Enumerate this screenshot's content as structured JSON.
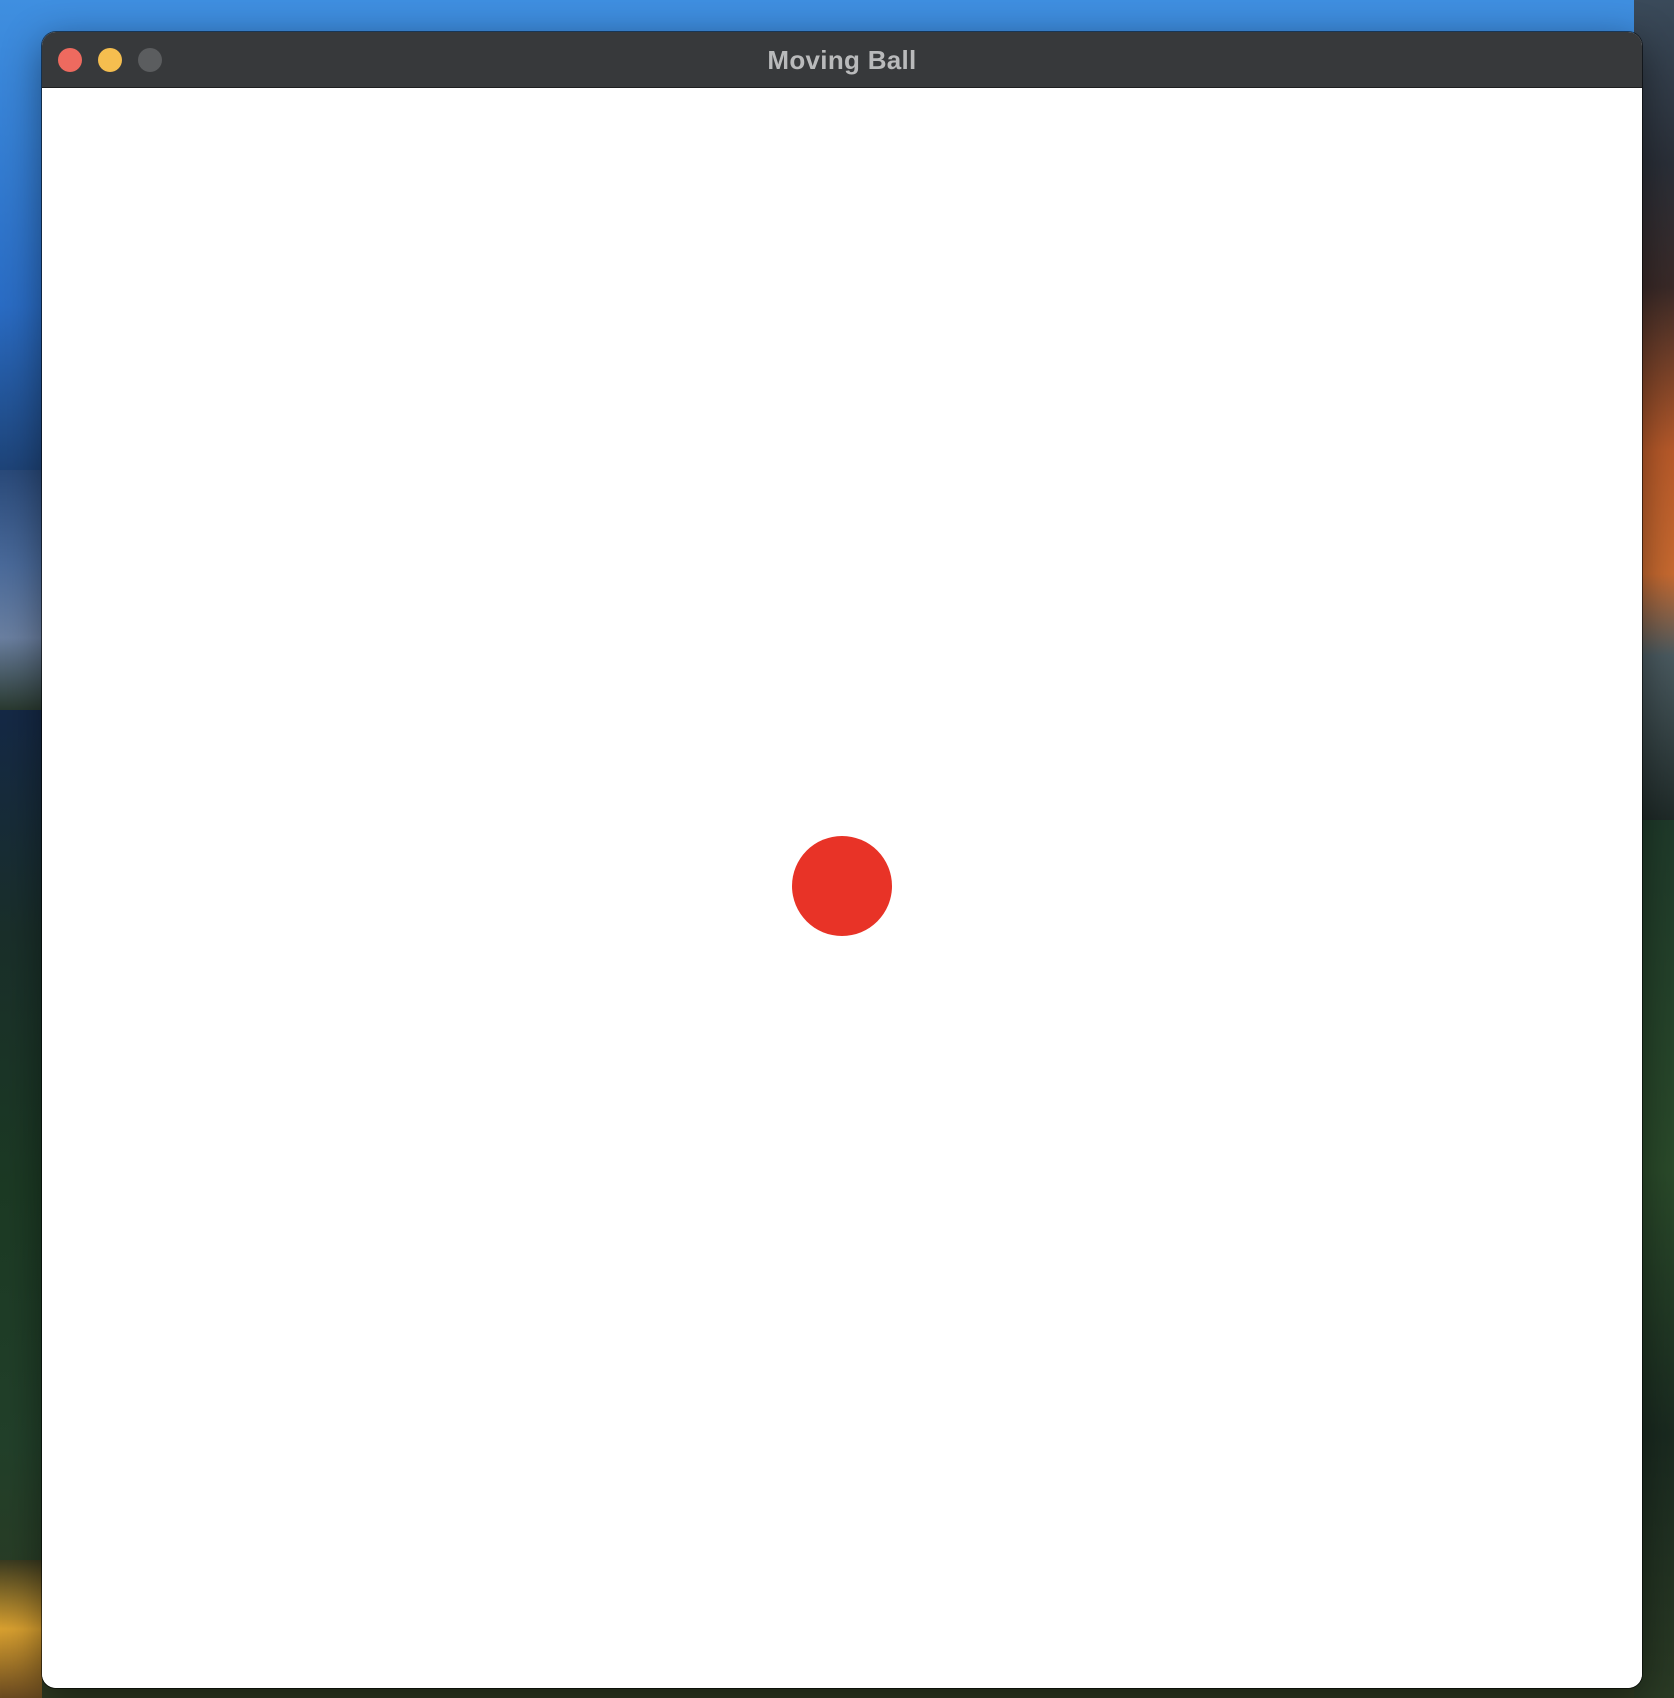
{
  "window": {
    "title": "Moving Ball",
    "controls": {
      "close_color": "#ee6a5f",
      "minimize_color": "#f5be4f",
      "zoom_color": "#5b5d5f"
    }
  },
  "canvas": {
    "background": "#ffffff",
    "ball": {
      "color": "#e83327",
      "shape": "circle"
    }
  }
}
